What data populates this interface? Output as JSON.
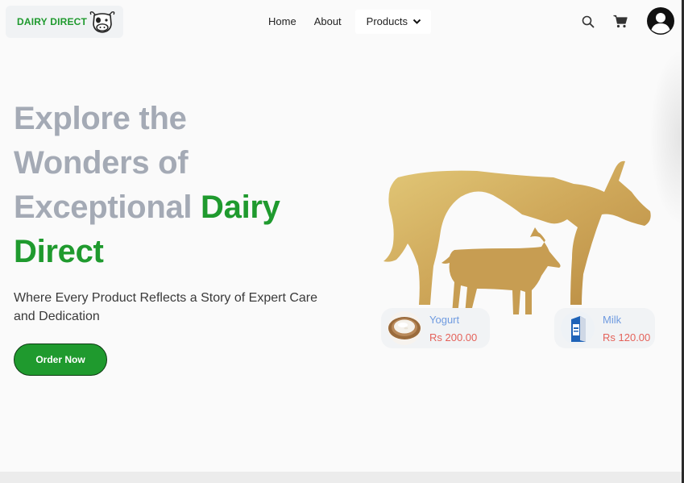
{
  "brand": {
    "name": "DAIRY DIRECT",
    "icon": "cow-icon"
  },
  "nav": {
    "home": "Home",
    "about": "About",
    "products": "Products",
    "products_icon": "chevron-down-icon"
  },
  "header_icons": {
    "search": "search-icon",
    "cart": "cart-icon",
    "avatar": "user-avatar-icon"
  },
  "hero": {
    "title_line1": "Explore the",
    "title_line2": "Wonders of",
    "title_line3": "Exceptional",
    "title_accent1": "Dairy",
    "title_accent2": "Direct",
    "subtitle": "Where Every Product Reflects a Story of Expert Care and Dedication",
    "cta": "Order Now"
  },
  "products": [
    {
      "name": "Yogurt",
      "price": "Rs 200.00",
      "icon": "yogurt-bowl-image"
    },
    {
      "name": "Milk",
      "price": "Rs 120.00",
      "icon": "milk-carton-image"
    }
  ],
  "colors": {
    "brand_green": "#1f9a2e",
    "title_gray": "#a4aab5",
    "product_name_blue": "#6f9be0",
    "price_red": "#e4625a",
    "animal_gold": "#c9a050"
  }
}
